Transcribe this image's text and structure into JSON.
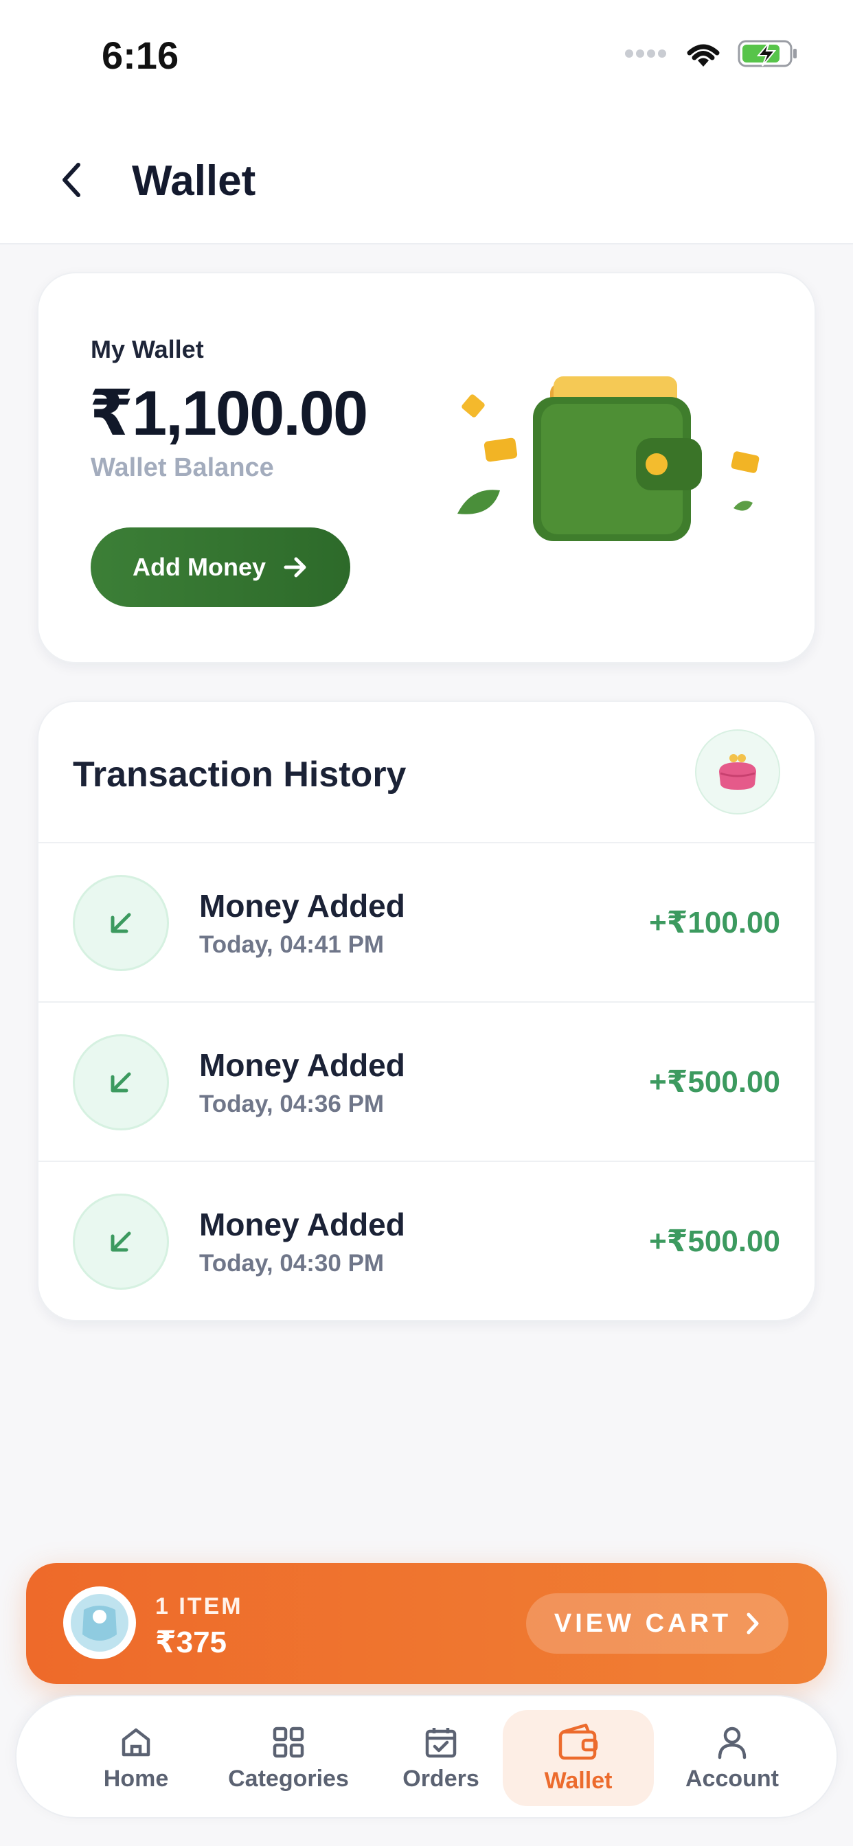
{
  "status_bar": {
    "time": "6:16"
  },
  "header": {
    "title": "Wallet"
  },
  "wallet_card": {
    "label": "My Wallet",
    "balance": "₹1,100.00",
    "balance_caption": "Wallet Balance",
    "add_money_label": "Add Money"
  },
  "transactions": {
    "title": "Transaction History",
    "items": [
      {
        "name": "Money Added",
        "time": "Today, 04:41 PM",
        "amount": "+₹100.00"
      },
      {
        "name": "Money Added",
        "time": "Today, 04:36 PM",
        "amount": "+₹500.00"
      },
      {
        "name": "Money Added",
        "time": "Today, 04:30 PM",
        "amount": "+₹500.00"
      }
    ]
  },
  "cart_bar": {
    "count": "1 ITEM",
    "price": "₹375",
    "button_label": "VIEW CART"
  },
  "nav": {
    "items": [
      {
        "label": "Home",
        "icon": "home-icon"
      },
      {
        "label": "Categories",
        "icon": "grid-icon"
      },
      {
        "label": "Orders",
        "icon": "calendar-check-icon"
      },
      {
        "label": "Wallet",
        "icon": "wallet-icon",
        "active": true
      },
      {
        "label": "Account",
        "icon": "user-icon"
      }
    ]
  },
  "colors": {
    "brand_green": "#2d6a2a",
    "positive_amount": "#3c9a5f",
    "accent_orange": "#ec6b2d"
  }
}
